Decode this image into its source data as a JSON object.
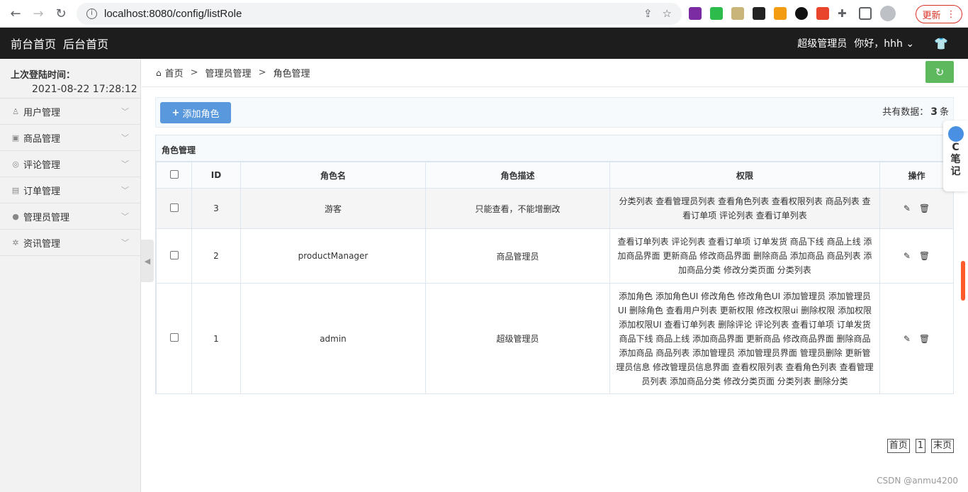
{
  "browser": {
    "url": "localhost:8080/config/listRole",
    "update_label": "更新"
  },
  "header": {
    "front_home": "前台首页",
    "back_home": "后台首页",
    "role": "超级管理员",
    "greeting": "你好，hhh"
  },
  "sidebar": {
    "login_label": "上次登陆时间：",
    "login_time": "2021-08-22 17:28:12",
    "items": [
      {
        "label": "用户管理",
        "icon": "user-icon"
      },
      {
        "label": "商品管理",
        "icon": "bag-icon"
      },
      {
        "label": "评论管理",
        "icon": "comment-icon"
      },
      {
        "label": "订单管理",
        "icon": "card-icon"
      },
      {
        "label": "管理员管理",
        "icon": "admin-icon"
      },
      {
        "label": "资讯管理",
        "icon": "gear-icon"
      }
    ]
  },
  "breadcrumb": {
    "home": "首页",
    "level1": "管理员管理",
    "level2": "角色管理"
  },
  "toolbar": {
    "add_label": "添加角色",
    "total_prefix": "共有数据：",
    "total_count": "3",
    "total_suffix": "条"
  },
  "panel": {
    "title": "角色管理",
    "columns": [
      "ID",
      "角色名",
      "角色描述",
      "权限",
      "操作"
    ],
    "rows": [
      {
        "id": "3",
        "name": "游客",
        "desc": "只能查看，不能增删改",
        "perms": "分类列表 查看管理员列表 查看角色列表 查看权限列表 商品列表 查看订单项 评论列表 查看订单列表"
      },
      {
        "id": "2",
        "name": "productManager",
        "desc": "商品管理员",
        "perms": "查看订单列表 评论列表 查看订单项 订单发货 商品下线 商品上线 添加商品界面 更新商品 修改商品界面 删除商品 添加商品 商品列表 添加商品分类 修改分类页面 分类列表"
      },
      {
        "id": "1",
        "name": "admin",
        "desc": "超级管理员",
        "perms": "添加角色 添加角色UI 修改角色 修改角色UI 添加管理员 添加管理员UI 删除角色 查看用户列表 更新权限 修改权限ui 删除权限 添加权限 添加权限UI 查看订单列表 删除评论 评论列表 查看订单项 订单发货 商品下线 商品上线 添加商品界面 更新商品 修改商品界面 删除商品 添加商品 商品列表 添加管理员 添加管理员界面 管理员删除 更新管理员信息 修改管理员信息界面 查看权限列表 查看角色列表 查看管理员列表 添加商品分类 修改分类页面 分类列表 删除分类"
      }
    ]
  },
  "pager": {
    "first": "首页",
    "current": "1",
    "last": "末页"
  },
  "side_widget": {
    "letter": "C",
    "text": "笔记"
  },
  "watermark": "CSDN @anmu4200"
}
